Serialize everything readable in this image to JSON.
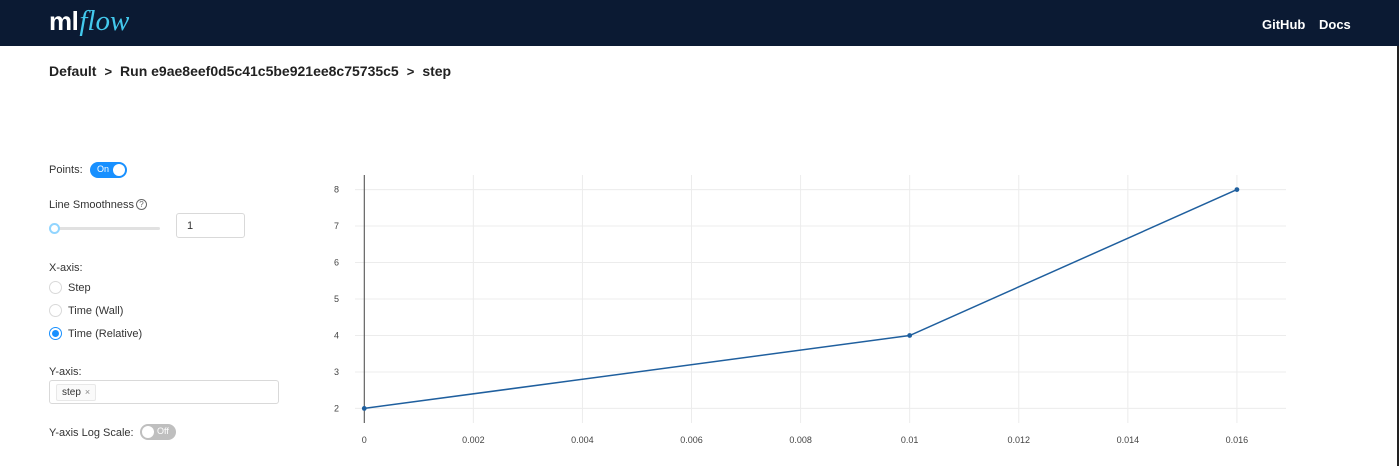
{
  "header": {
    "logo_ml": "ml",
    "logo_flow": "flow",
    "nav": {
      "github": "GitHub",
      "docs": "Docs"
    },
    "colors": {
      "bar": "#0b1a33",
      "accent": "#43c9ed"
    }
  },
  "breadcrumb": {
    "experiment": "Default",
    "separator": ">",
    "run": "Run e9ae8eef0d5c41c5be921ee8c75735c5",
    "metric": "step"
  },
  "controls": {
    "points_label": "Points:",
    "points_toggle_text": "On",
    "points_on": true,
    "smoothness_label": "Line Smoothness",
    "smoothness_help_icon": "question-circle-icon",
    "smoothness_help_glyph": "?",
    "smoothness_value": "1",
    "smoothness_slider_fraction": 0.0,
    "xaxis_label": "X-axis:",
    "xaxis_options": [
      {
        "label": "Step",
        "checked": false
      },
      {
        "label": "Time (Wall)",
        "checked": false
      },
      {
        "label": "Time (Relative)",
        "checked": true
      }
    ],
    "yaxis_label": "Y-axis:",
    "yaxis_tag": "step",
    "yaxis_tag_close": "×",
    "logscale_label": "Y-axis Log Scale:",
    "logscale_toggle_text": "Off",
    "logscale_on": false,
    "accent_color": "#1890ff"
  },
  "chart_data": {
    "type": "line",
    "x": [
      0,
      0.01,
      0.016
    ],
    "series": [
      {
        "values": [
          2,
          4,
          8
        ],
        "color": "#1f5f9e"
      }
    ],
    "xticks": [
      0,
      0.002,
      0.004,
      0.006,
      0.008,
      0.01,
      0.012,
      0.014,
      0.016
    ],
    "xtick_labels": [
      "0",
      "0.002",
      "0.004",
      "0.006",
      "0.008",
      "0.01",
      "0.012",
      "0.014",
      "0.016"
    ],
    "yticks": [
      2,
      3,
      4,
      5,
      6,
      7,
      8
    ],
    "ytick_labels": [
      "2",
      "3",
      "4",
      "5",
      "6",
      "7",
      "8"
    ],
    "xlim": [
      -0.00017,
      0.0169
    ],
    "ylim": [
      1.6,
      8.4
    ],
    "grid": true,
    "markers": true
  }
}
